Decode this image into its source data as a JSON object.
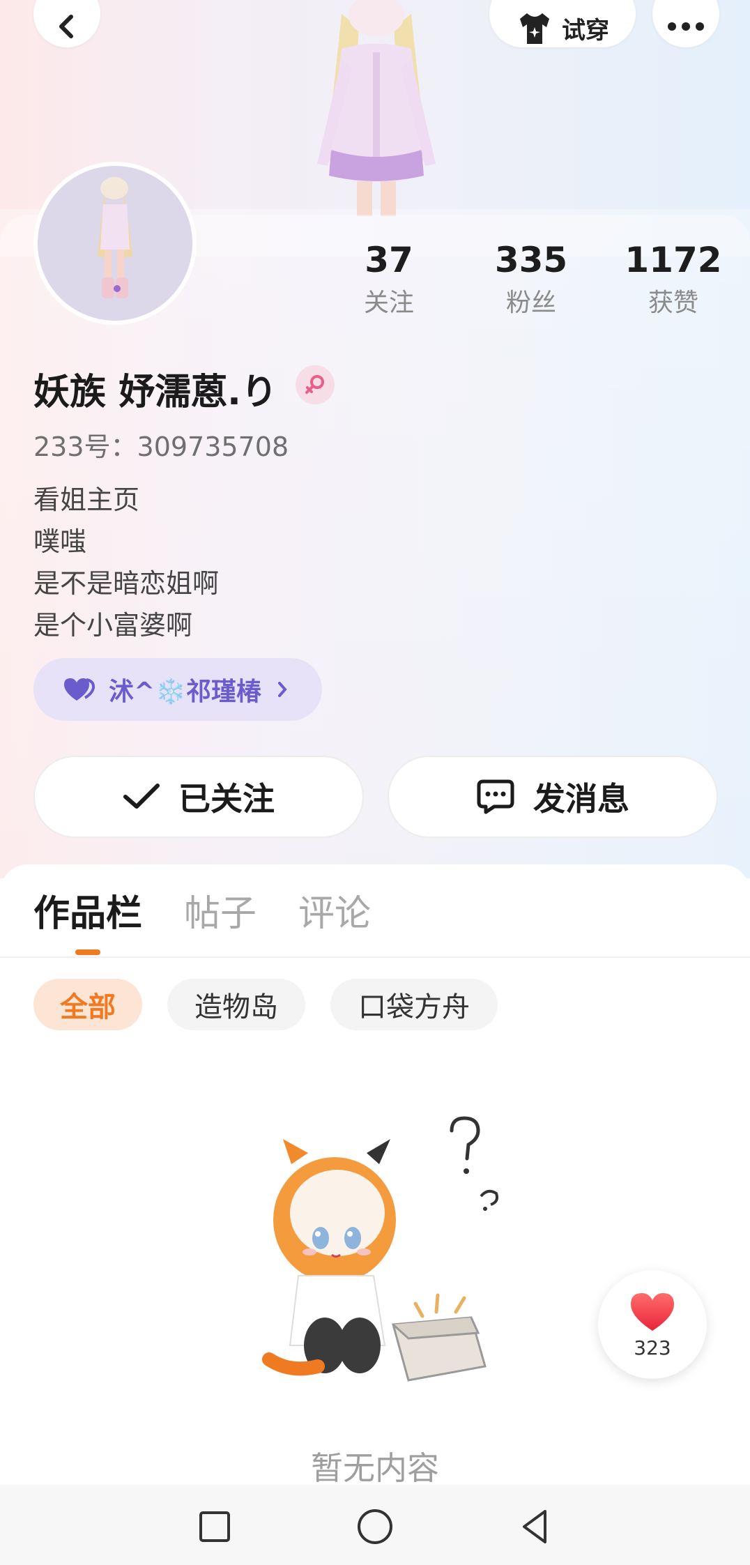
{
  "header": {
    "back_icon": "chevron-left-icon",
    "tryon_label": "试穿",
    "tryon_icon": "shirt-icon",
    "more_icon": "more-dots-icon"
  },
  "profile": {
    "nickname": "妖族 妤濡蒽.り",
    "gender_icon": "female-icon",
    "uid_label": "233号：",
    "uid_value": "309735708",
    "stats": [
      {
        "value": "37",
        "label": "关注"
      },
      {
        "value": "335",
        "label": "粉丝"
      },
      {
        "value": "1172",
        "label": "获赞"
      }
    ],
    "bio": [
      "看姐主页",
      "噗嗤",
      "是不是暗恋姐啊",
      "是个小富婆啊"
    ],
    "tag": {
      "icon": "heart-icon",
      "text": "沭^❄️祁瑾椿"
    }
  },
  "actions": {
    "follow_label": "已关注",
    "message_label": "发消息"
  },
  "tabs": [
    {
      "label": "作品栏",
      "active": true
    },
    {
      "label": "帖子",
      "active": false
    },
    {
      "label": "评论",
      "active": false
    }
  ],
  "filters": [
    {
      "label": "全部",
      "active": true
    },
    {
      "label": "造物岛",
      "active": false
    },
    {
      "label": "口袋方舟",
      "active": false
    }
  ],
  "empty": {
    "text": "暂无内容"
  },
  "like_float": {
    "count": "323"
  },
  "colors": {
    "accent": "#f07a22",
    "tag_text": "#6a5ccc",
    "tag_bg": "#e7e2f8"
  }
}
